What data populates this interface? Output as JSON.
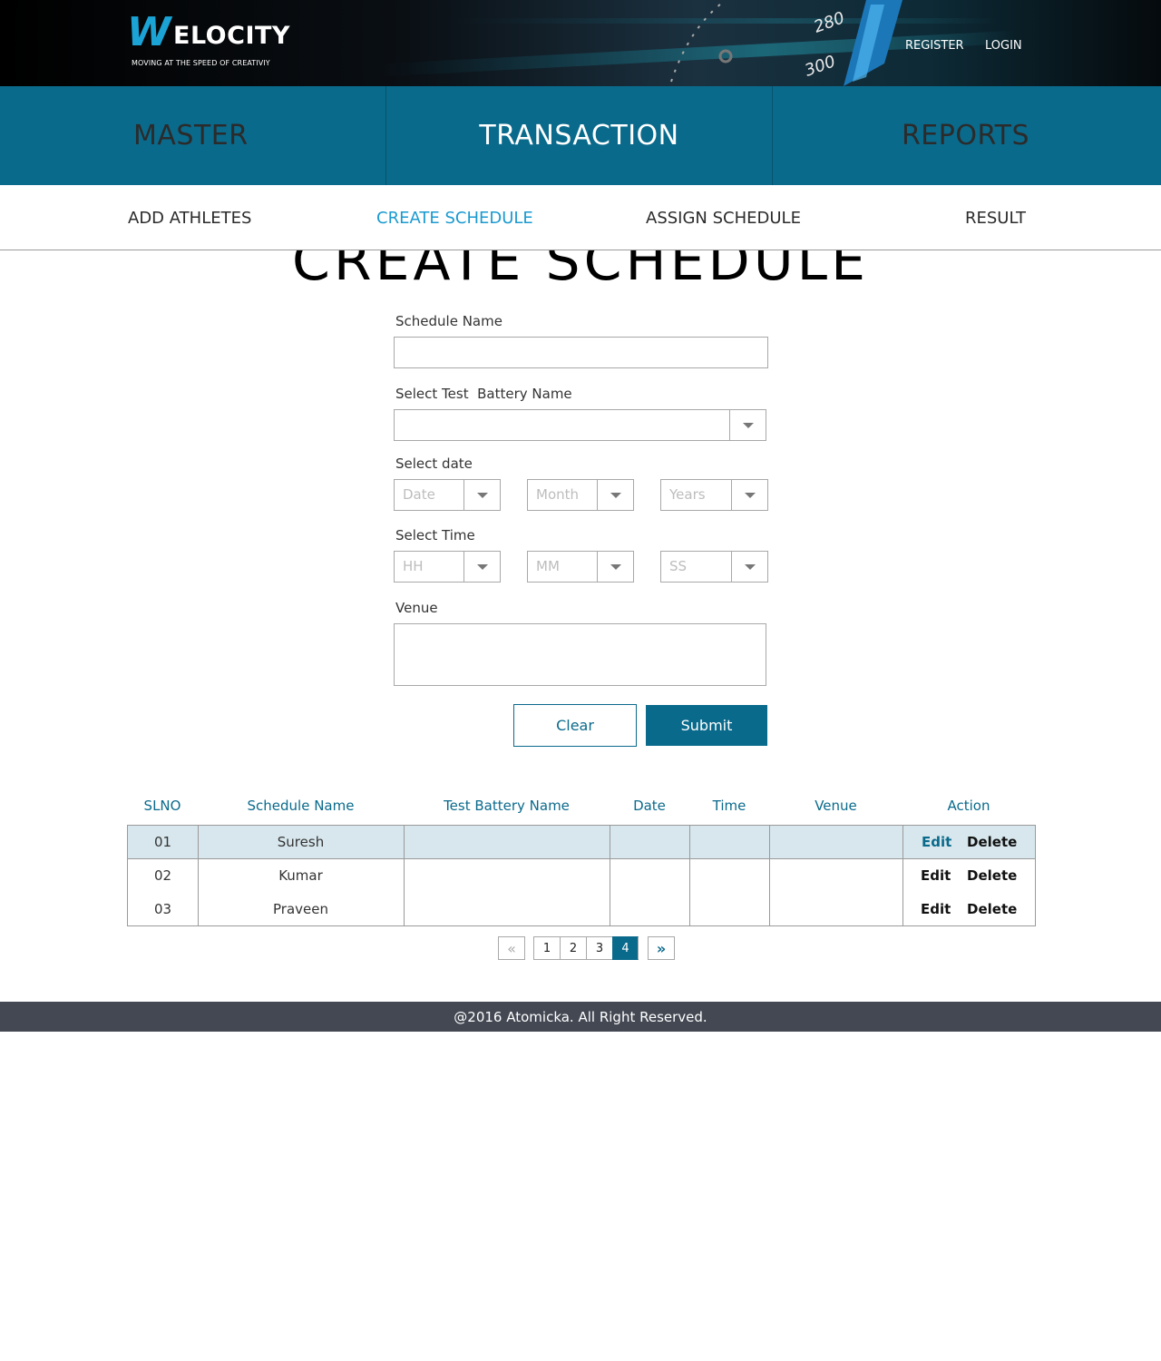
{
  "brand": {
    "logo_letter": "W",
    "logo_text": "ELOCITY",
    "tagline": "MOVING AT THE SPEED OF CREATIVIY",
    "speedometer_labels": [
      "280",
      "300"
    ],
    "accent_color": "#1ba3d6"
  },
  "header": {
    "register_label": "REGISTER",
    "login_label": "LOGIN"
  },
  "main_nav": {
    "tabs": [
      {
        "label": "MASTER"
      },
      {
        "label": "TRANSACTION",
        "active": true
      },
      {
        "label": "REPORTS"
      }
    ],
    "color": "#0a6a8c"
  },
  "sub_nav": {
    "items": [
      {
        "label": "ADD ATHLETES"
      },
      {
        "label": "CREATE SCHEDULE",
        "active": true
      },
      {
        "label": "ASSIGN SCHEDULE"
      },
      {
        "label": "RESULT"
      }
    ],
    "active_color": "#1a9ad0"
  },
  "page": {
    "title": "CREATE SCHEDULE"
  },
  "form": {
    "schedule_name_label": "Schedule Name",
    "schedule_name_value": "",
    "battery_label": "Select Test  Battery Name",
    "battery_value": "",
    "date_label": "Select date",
    "date_placeholder": "Date",
    "month_placeholder": "Month",
    "year_placeholder": "Years",
    "time_label": "Select Time",
    "hh_placeholder": "HH",
    "mm_placeholder": "MM",
    "ss_placeholder": "SS",
    "venue_label": "Venue",
    "venue_value": "",
    "clear_label": "Clear",
    "submit_label": "Submit"
  },
  "table": {
    "headers": [
      "SLNO",
      "Schedule Name",
      "Test Battery Name",
      "Date",
      "Time",
      "Venue",
      "Action"
    ],
    "rows": [
      {
        "slno": "01",
        "schedule_name": "Suresh",
        "test_battery": "",
        "date": "",
        "time": "",
        "venue": "",
        "edit": "Edit",
        "delete": "Delete"
      },
      {
        "slno": "02",
        "schedule_name": "Kumar",
        "test_battery": "",
        "date": "",
        "time": "",
        "venue": "",
        "edit": "Edit",
        "delete": "Delete"
      },
      {
        "slno": "03",
        "schedule_name": "Praveen",
        "test_battery": "",
        "date": "",
        "time": "",
        "venue": "",
        "edit": "Edit",
        "delete": "Delete"
      }
    ]
  },
  "pagination": {
    "prev_icon": "double-chevron-left-icon",
    "next_icon": "double-chevron-right-icon",
    "pages": [
      "1",
      "2",
      "3",
      "4"
    ],
    "current": "4"
  },
  "footer": {
    "text": "@2016 Atomicka. All Right Reserved."
  }
}
